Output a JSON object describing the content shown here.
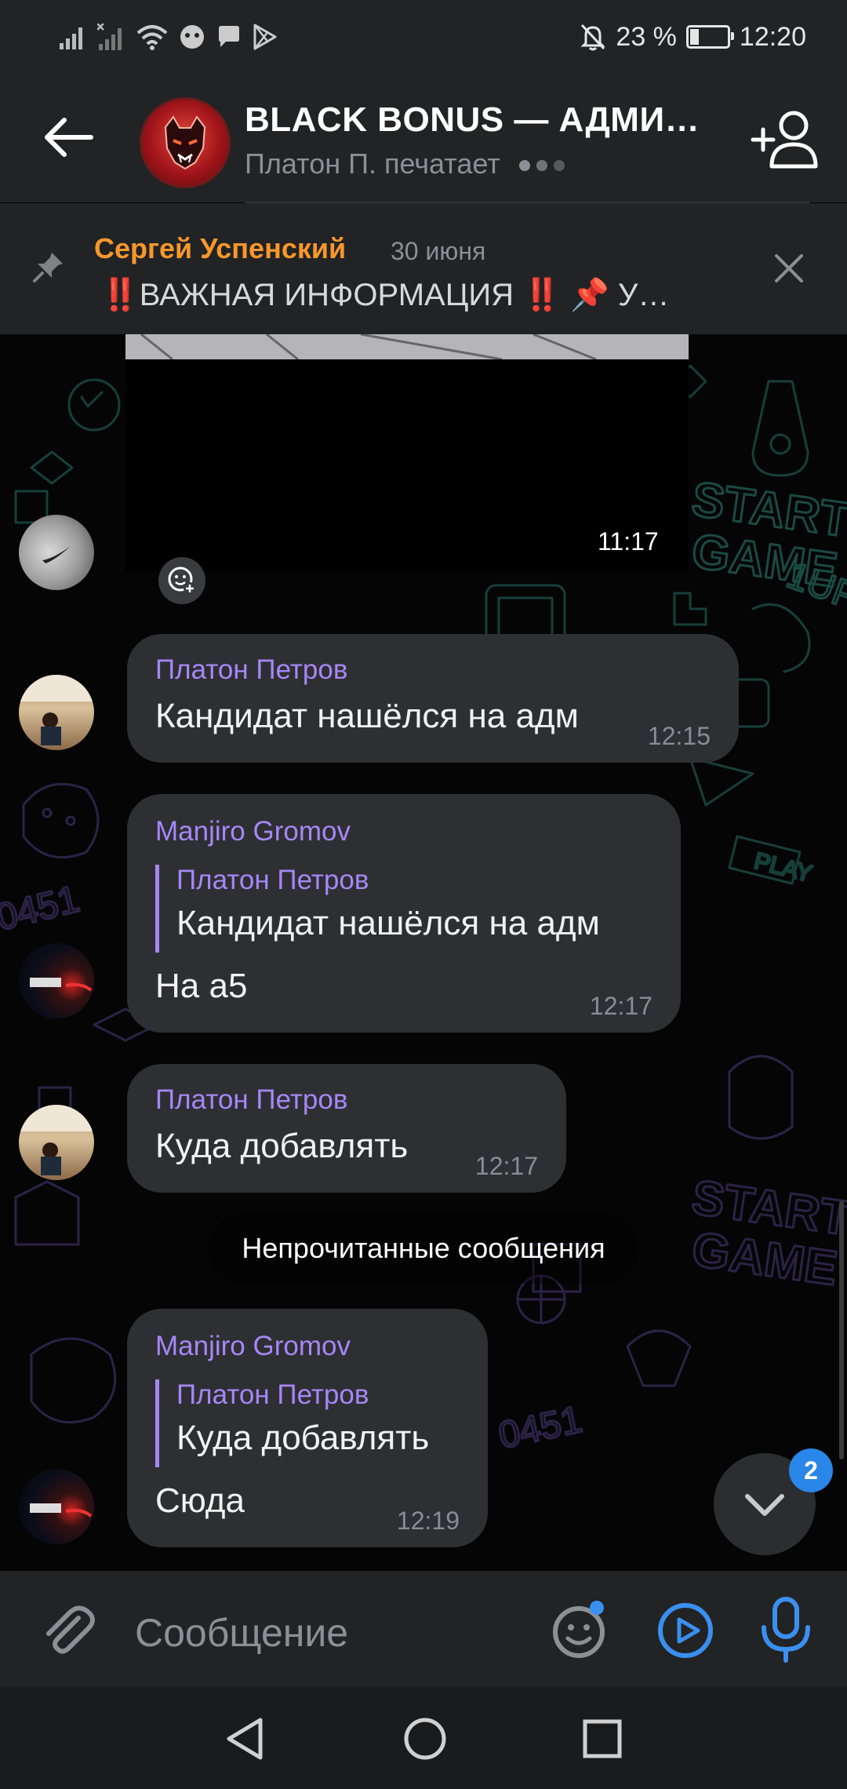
{
  "status_bar": {
    "battery_text": "23 %",
    "battery_level": 0.23,
    "time": "12:20"
  },
  "header": {
    "title": "BLACK BONUS — АДМИНИСТРАЦИЯ",
    "subtitle": "Платон П. печатает",
    "back_icon": "arrow-left-icon",
    "add_icon": "add-user-icon"
  },
  "pinned": {
    "author": "Сергей Успенский",
    "date": "30 июня",
    "text": "‼️ВАЖНАЯ ИНФОРМАЦИЯ ‼️  📌 У…"
  },
  "media": {
    "time": "11:17"
  },
  "messages": [
    {
      "author": "Платон Петров",
      "text": "Кандидат нашёлся на адм",
      "time": "12:15"
    },
    {
      "author": "Manjiro Gromov",
      "reply_author": "Платон Петров",
      "reply_text": "Кандидат нашёлся на адм",
      "text": "На а5",
      "time": "12:17"
    },
    {
      "author": "Платон Петров",
      "text": "Куда добавлять",
      "time": "12:17"
    },
    {
      "author": "Manjiro Gromov",
      "reply_author": "Платон Петров",
      "reply_text": "Куда добавлять",
      "text": "Сюда",
      "time": "12:19"
    }
  ],
  "unread_label": "Непрочитанные сообщения",
  "scroll_down": {
    "badge": "2"
  },
  "input": {
    "placeholder": "Сообщение"
  },
  "colors": {
    "bar_bg": "#222324",
    "bubble_bg": "#2e2f33",
    "name_color": "#a687f6",
    "pin_author": "#f7972c",
    "accent_blue": "#3a8ff0"
  }
}
